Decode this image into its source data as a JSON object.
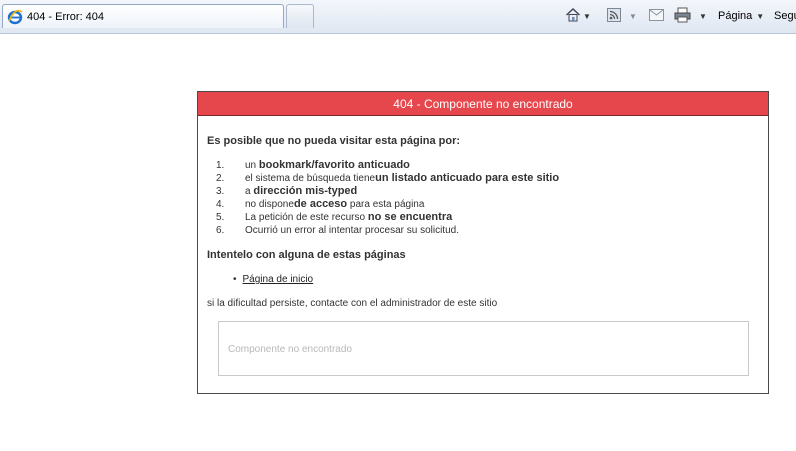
{
  "browser": {
    "tab_title": "404 - Error: 404",
    "commands": {
      "page_label": "Página",
      "security_label": "Segu"
    }
  },
  "error": {
    "header": "404 - Componente no encontrado",
    "intro": "Es posible que no pueda visitar esta página por:",
    "reasons": [
      {
        "num": "1.",
        "pre": "un ",
        "bold": "bookmark/favorito anticuado",
        "post": ""
      },
      {
        "num": "2.",
        "pre": "el sistema de búsqueda tiene",
        "bold": "un listado anticuado para este sitio",
        "post": ""
      },
      {
        "num": "3.",
        "pre": "a ",
        "bold": "dirección mis-typed",
        "post": ""
      },
      {
        "num": "4.",
        "pre": "no dispone",
        "bold": "de acceso",
        "post": " para esta página"
      },
      {
        "num": "5.",
        "pre": "La petición de este recurso ",
        "bold": "no se encuentra",
        "post": ""
      },
      {
        "num": "6.",
        "pre": "Ocurrió un error al intentar procesar su solicitud.",
        "bold": "",
        "post": ""
      }
    ],
    "suggestion_heading": "Intentelo con alguna de estas páginas",
    "pages": [
      {
        "bullet": "•",
        "label": "Página de inicio"
      }
    ],
    "contact": "si la dificultad persiste, contacte con el administrador de este sitio",
    "detail_message": "Componente no encontrado"
  }
}
